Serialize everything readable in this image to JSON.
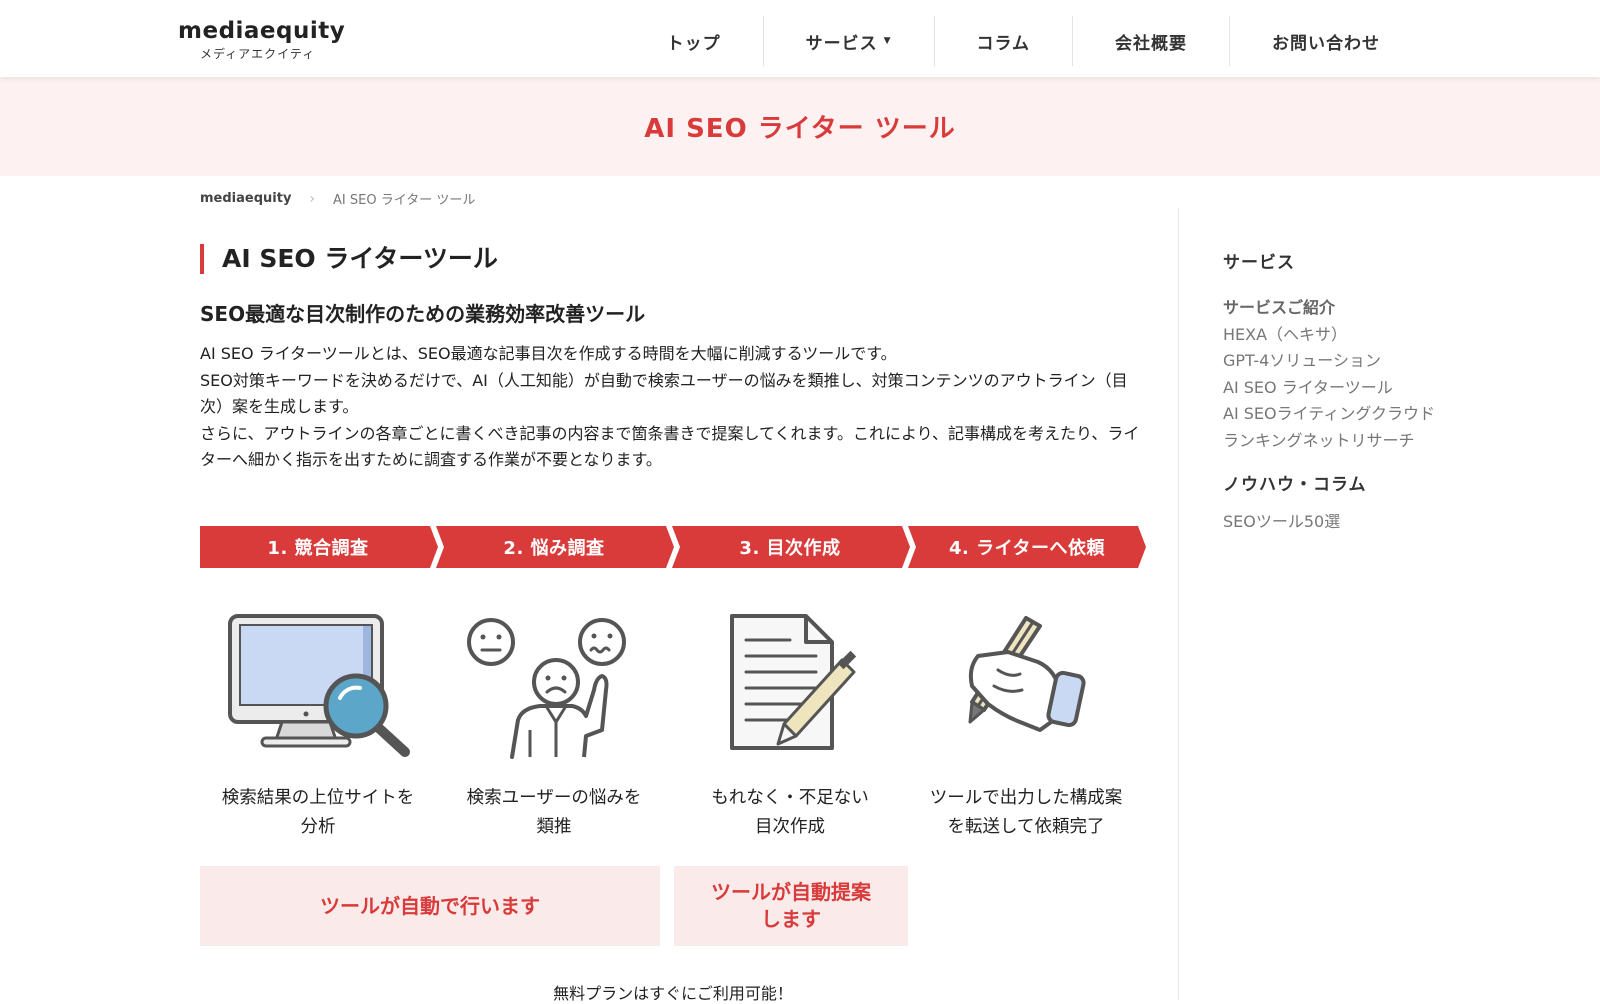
{
  "logo": {
    "name": "mediaequity",
    "subtitle": "メディアエクイティ"
  },
  "nav": [
    {
      "label": "トップ"
    },
    {
      "label": "サービス"
    },
    {
      "label": "コラム"
    },
    {
      "label": "会社概要"
    },
    {
      "label": "お問い合わせ"
    }
  ],
  "hero": {
    "title": "AI SEO ライター ツール"
  },
  "breadcrumb": {
    "home": "mediaequity",
    "current": "AI SEO ライター ツール"
  },
  "main": {
    "heading": "AI SEO ライターツール",
    "subheading": "SEO最適な目次制作のための業務効率改善ツール",
    "paragraphs": [
      "AI SEO ライターツールとは、SEO最適な記事目次を作成する時間を大幅に削減するツールです。",
      "SEO対策キーワードを決めるだけで、AI（人工知能）が自動で検索ユーザーの悩みを類推し、対策コンテンツのアウトライン（目次）案を生成します。",
      "さらに、アウトラインの各章ごとに書くべき記事の内容まで箇条書きで提案してくれます。これにより、記事構成を考えたり、ライターへ細かく指示を出すために調査する作業が不要となります。"
    ]
  },
  "steps": [
    {
      "label": "1. 競合調査",
      "caption_line1": "検索結果の上位サイトを",
      "caption_line2": "分析",
      "icon": "monitor-search-icon"
    },
    {
      "label": "2. 悩み調査",
      "caption_line1": "検索ユーザーの悩みを",
      "caption_line2": "類推",
      "icon": "worried-user-icon"
    },
    {
      "label": "3. 目次作成",
      "caption_line1": "もれなく・不足ない",
      "caption_line2": "目次作成",
      "icon": "document-pen-icon"
    },
    {
      "label": "4. ライターへ依頼",
      "caption_line1": "ツールで出力した構成案",
      "caption_line2": "を転送して依頼完了",
      "icon": "writing-hand-icon"
    }
  ],
  "notes": {
    "auto": "ツールが自動で行います",
    "suggest_line1": "ツールが自動提案",
    "suggest_line2": "します"
  },
  "bottom_text": "無料プランはすぐにご利用可能！",
  "sidebar": {
    "title": "サービス",
    "links": [
      {
        "label": "サービスご紹介"
      },
      {
        "label": "HEXA（ヘキサ）"
      },
      {
        "label": "GPT-4ソリューション"
      },
      {
        "label": "AI SEO ライターツール"
      },
      {
        "label": "AI SEOライティングクラウド"
      },
      {
        "label": "ランキングネットリサーチ"
      }
    ],
    "title2": "ノウハウ・コラム",
    "links2": [
      {
        "label": "SEOツール50選"
      }
    ]
  },
  "colors": {
    "accent": "#d93a3a",
    "hero_bg": "#fdf2f1",
    "note_bg": "#fbeaea",
    "monitor_screen": "#c9d8f3",
    "magnifier_glass": "#5ba6c9",
    "pencil": "#eee4bd"
  }
}
